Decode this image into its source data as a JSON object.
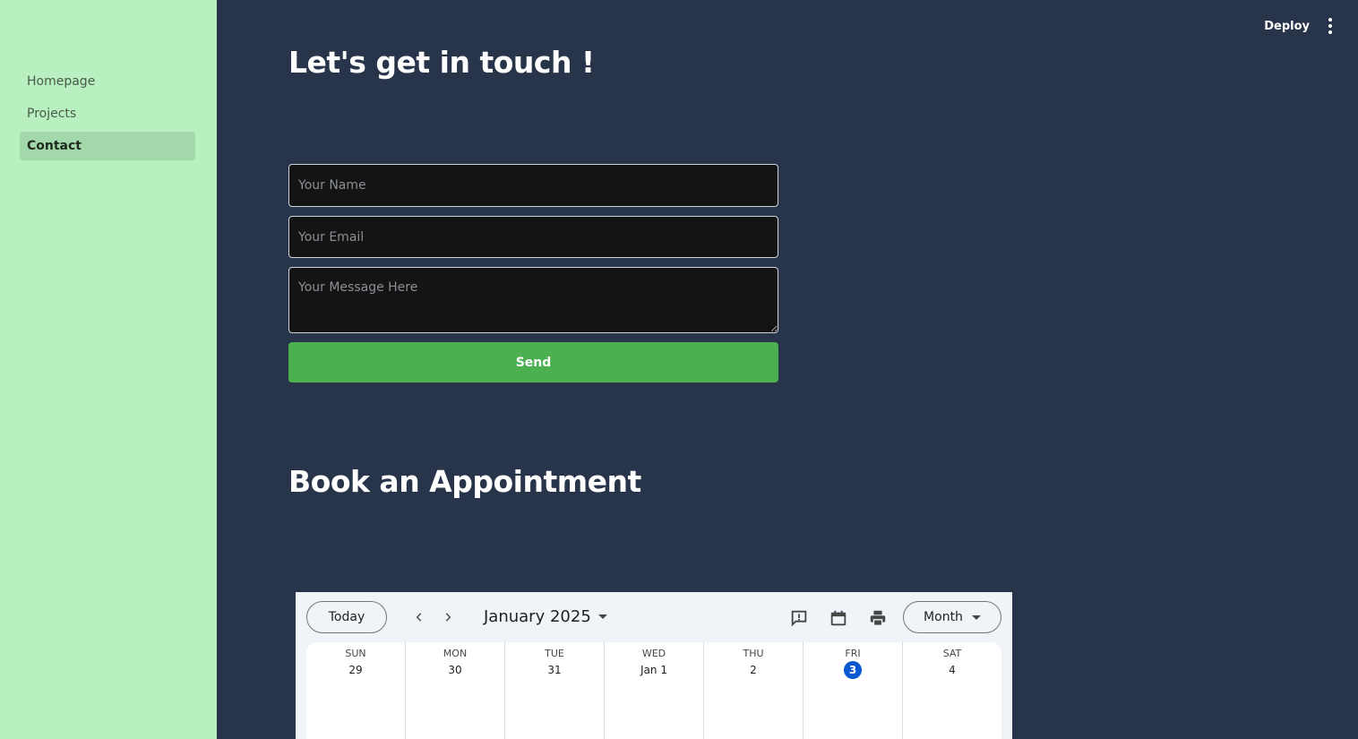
{
  "sidebar": {
    "items": [
      {
        "label": "Homepage"
      },
      {
        "label": "Projects"
      },
      {
        "label": "Contact",
        "active": true
      }
    ]
  },
  "header": {
    "deploy_label": "Deploy",
    "menu_icon": "kebab-menu-icon"
  },
  "contact": {
    "title": "Let's get in touch !",
    "name_placeholder": "Your Name",
    "email_placeholder": "Your Email",
    "message_placeholder": "Your Message Here",
    "send_label": "Send",
    "send_color": "#4caf50"
  },
  "appointment": {
    "title": "Book an Appointment"
  },
  "calendar": {
    "today_label": "Today",
    "month_label": "January 2025",
    "view_label": "Month",
    "icons": [
      "prev-chevron-icon",
      "next-chevron-icon",
      "feedback-icon",
      "calendar-icon",
      "print-icon"
    ],
    "accent_color": "#0b57d0",
    "days": [
      {
        "dow": "SUN",
        "date": "29"
      },
      {
        "dow": "MON",
        "date": "30"
      },
      {
        "dow": "TUE",
        "date": "31"
      },
      {
        "dow": "WED",
        "date": "Jan 1"
      },
      {
        "dow": "THU",
        "date": "2"
      },
      {
        "dow": "FRI",
        "date": "3",
        "today": true
      },
      {
        "dow": "SAT",
        "date": "4"
      }
    ]
  }
}
